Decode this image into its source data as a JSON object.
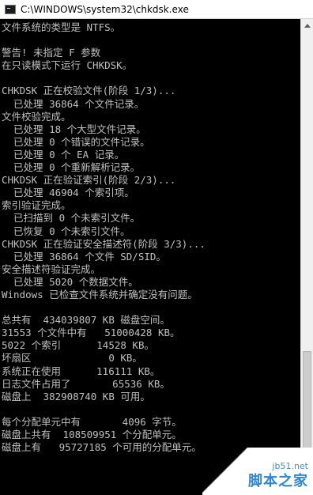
{
  "window": {
    "title": "C:\\WINDOWS\\system32\\chkdsk.exe",
    "icon": "console-window-icon"
  },
  "console": {
    "lines": [
      "文件系统的类型是 NTFS。",
      "",
      "警告! 未指定 F 参数",
      "在只读模式下运行 CHKDSK。",
      "",
      "CHKDSK 正在校验文件(阶段 1/3)...",
      "  已处理 36864 个文件记录。",
      "文件校验完成。",
      "  已处理 18 个大型文件记录。",
      "  已处理 0 个错误的文件记录。",
      "  已处理 0 个 EA 记录。",
      "  已处理 0 个重新解析记录。",
      "CHKDSK 正在验证索引(阶段 2/3)...",
      "  已处理 46904 个索引项。",
      "索引验证完成。",
      "  已扫描到 0 个未索引文件。",
      "  已恢复 0 个未索引文件。",
      "CHKDSK 正在验证安全描述符(阶段 3/3)...",
      "  已处理 36864 个文件 SD/SID。",
      "安全描述符验证完成。",
      "  已处理 5020 个数据文件。",
      "Windows 已检查文件系统并确定没有问题。",
      "",
      "总共有  434039807 KB 磁盘空间。",
      "31553 个文件中有   51000428 KB。",
      "5022 个索引      14528 KB。",
      "坏扇区             0 KB。",
      "系统正在使用      116111 KB。",
      "日志文件占用了       65536 KB。",
      "磁盘上  382908740 KB 可用。",
      "",
      "每个分配单元中有       4096 字节。",
      "磁盘上共有  108509951 个分配单元。",
      "磁盘上有   95727185 个可用的分配单元。"
    ]
  },
  "watermark": {
    "site": "jb51.net",
    "name": "脚本之家"
  },
  "colors": {
    "console_bg": "#000000",
    "console_text": "#c0c0c0",
    "titlebar_bg": "#ffffff",
    "watermark_blue": "#2f86d2"
  }
}
